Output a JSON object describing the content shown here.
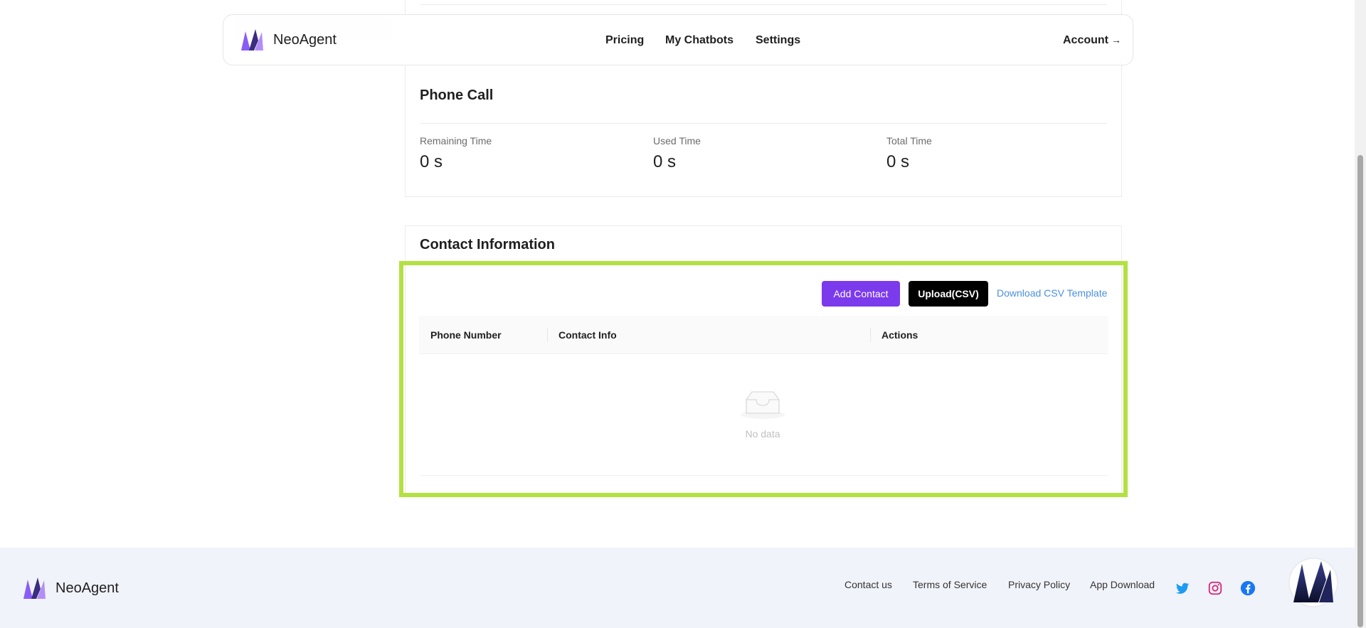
{
  "app": {
    "name": "NeoAgent"
  },
  "nav": {
    "brand": "NeoAgent",
    "links": [
      "Pricing",
      "My Chatbots",
      "Settings"
    ],
    "account": "Account",
    "account_arrow": "→"
  },
  "usage": {
    "phone_call": {
      "title": "Phone Call",
      "stats": [
        {
          "label": "Remaining Time",
          "value": "0 s"
        },
        {
          "label": "Used Time",
          "value": "0 s"
        },
        {
          "label": "Total Time",
          "value": "0 s"
        }
      ]
    }
  },
  "contact": {
    "title": "Contact Information",
    "add_button": "Add Contact",
    "upload_button": "Upload(CSV)",
    "template_link": "Download CSV Template",
    "columns": [
      "Phone Number",
      "Contact Info",
      "Actions"
    ],
    "empty_text": "No data"
  },
  "footer": {
    "brand": "NeoAgent",
    "links": [
      "Contact us",
      "Terms of Service",
      "Privacy Policy",
      "App Download"
    ],
    "social": [
      "twitter-icon",
      "instagram-icon",
      "facebook-icon"
    ]
  },
  "colors": {
    "accent": "#7c3aed",
    "highlight": "#b3e141",
    "link": "#4a90e2",
    "footer_bg": "#f0f3fa"
  }
}
